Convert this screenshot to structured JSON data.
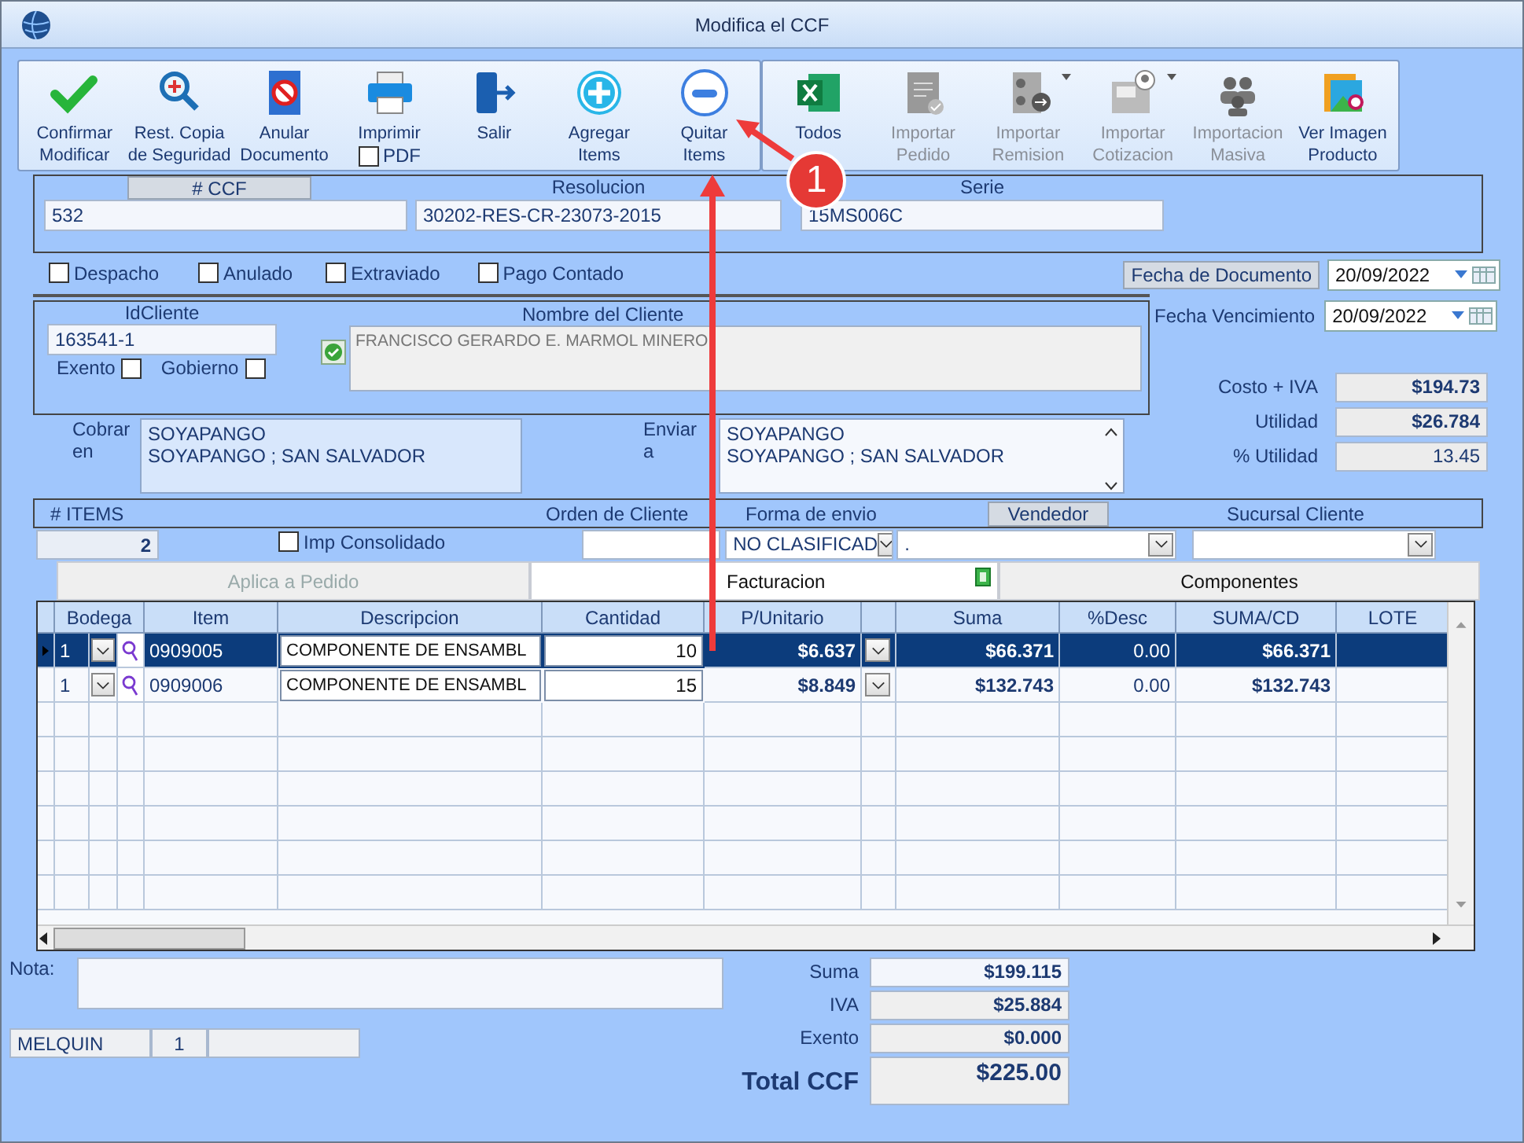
{
  "window": {
    "title": "Modifica el CCF"
  },
  "toolbar": {
    "groups": [
      {
        "buttons": [
          {
            "kind": "confirm",
            "lines": [
              "Confirmar",
              "Modificar"
            ],
            "disabled": false
          },
          {
            "kind": "restore",
            "lines": [
              "Rest. Copia",
              "de Seguridad"
            ],
            "disabled": false
          },
          {
            "kind": "void",
            "lines": [
              "Anular",
              "Documento"
            ],
            "disabled": false
          },
          {
            "kind": "print",
            "lines": [
              "Imprimir"
            ],
            "disabled": false,
            "checkbox": {
              "label": "PDF",
              "checked": false
            }
          },
          {
            "kind": "exit",
            "lines": [
              "Salir"
            ],
            "disabled": false
          },
          {
            "kind": "add",
            "lines": [
              "Agregar",
              "Items"
            ],
            "disabled": false
          },
          {
            "kind": "remove",
            "lines": [
              "Quitar",
              "Items"
            ],
            "disabled": false
          }
        ]
      },
      {
        "buttons": [
          {
            "kind": "excel",
            "lines": [
              "Todos"
            ],
            "disabled": false
          },
          {
            "kind": "import_order",
            "lines": [
              "Importar",
              "Pedido"
            ],
            "disabled": true
          },
          {
            "kind": "import_remission",
            "lines": [
              "Importar",
              "Remision"
            ],
            "disabled": true,
            "menu": true
          },
          {
            "kind": "import_quote",
            "lines": [
              "Importar",
              "Cotizacion"
            ],
            "disabled": true,
            "menu": true
          },
          {
            "kind": "mass_import",
            "lines": [
              "Importacion",
              "Masiva"
            ],
            "disabled": true
          },
          {
            "kind": "image",
            "lines": [
              "Ver Imagen",
              "Producto"
            ],
            "disabled": false
          }
        ]
      }
    ]
  },
  "document": {
    "fields": [
      {
        "label": "# CCF",
        "value": "532",
        "highlighted": true
      },
      {
        "label": "Resolucion",
        "value": "30202-RES-CR-23073-2015",
        "highlighted": false
      },
      {
        "label": "Serie",
        "value": "15MS006C",
        "highlighted": false
      }
    ]
  },
  "flags": [
    {
      "label": "Despacho",
      "checked": false
    },
    {
      "label": "Anulado",
      "checked": false
    },
    {
      "label": "Extraviado",
      "checked": false
    },
    {
      "label": "Pago Contado",
      "checked": false
    }
  ],
  "fecha_documento": {
    "label": "Fecha de  Documento",
    "value": "20/09/2022"
  },
  "cliente": {
    "id_label": "IdCliente",
    "id": "163541-1",
    "options": [
      {
        "label": "Exento",
        "checked": false
      },
      {
        "label": "Gobierno",
        "checked": false
      }
    ],
    "verified": true,
    "name_label": "Nombre del Cliente",
    "name": "FRANCISCO GERARDO E. MARMOL MINERO"
  },
  "fecha_vencimiento": {
    "label": "Fecha Vencimiento",
    "value": "20/09/2022"
  },
  "costos": [
    {
      "label": "Costo + IVA",
      "value": "$194.73",
      "bold": true
    },
    {
      "label": "Utilidad",
      "value": "$26.784",
      "bold": true
    },
    {
      "label": "% Utilidad",
      "value": "13.45",
      "bold": false
    }
  ],
  "cobrar": {
    "label": "Cobrar en",
    "lines": [
      "SOYAPANGO",
      "SOYAPANGO ; SAN SALVADOR"
    ]
  },
  "enviar": {
    "label": "Enviar a",
    "lines": [
      "SOYAPANGO",
      "SOYAPANGO ; SAN SALVADOR"
    ]
  },
  "items_bar": {
    "count_label": "# ITEMS",
    "count": "2",
    "consolidado": {
      "label": "Imp Consolidado",
      "checked": false
    },
    "orden_label": "Orden de Cliente",
    "forma_label": "Forma de envio",
    "forma": "NO CLASIFICAD",
    "vendedor_label": "Vendedor",
    "vendedor": ".",
    "sucursal_label": "Sucursal Cliente"
  },
  "tabs": [
    {
      "label": "Aplica a Pedido",
      "selected": false,
      "disabled": true
    },
    {
      "label": "Facturacion",
      "selected": true,
      "disabled": false
    },
    {
      "label": "Componentes",
      "selected": false,
      "disabled": false
    }
  ],
  "grid": {
    "columns": [
      "Bodega",
      "Item",
      "Descripcion",
      "Cantidad",
      "P/Unitario",
      "Suma",
      "%Desc",
      "SUMA/CD",
      "LOTE"
    ],
    "rows": [
      {
        "selected": true,
        "bodega": "1",
        "item": "0909005",
        "descripcion": "COMPONENTE DE ENSAMBL",
        "cantidad": "10",
        "p_unitario": "$6.637",
        "suma": "$66.371",
        "desc": "0.00",
        "suma_cd": "$66.371"
      },
      {
        "selected": false,
        "bodega": "1",
        "item": "0909006",
        "descripcion": "COMPONENTE DE ENSAMBL",
        "cantidad": "15",
        "p_unitario": "$8.849",
        "suma": "$132.743",
        "desc": "0.00",
        "suma_cd": "$132.743"
      }
    ]
  },
  "nota": {
    "label": "Nota:"
  },
  "footer_fields": [
    "MELQUIN",
    "1"
  ],
  "totales": [
    {
      "label": "Suma",
      "value": "$199.115"
    },
    {
      "label": "IVA",
      "value": "$25.884"
    },
    {
      "label": "Exento",
      "value": "$0.000"
    }
  ],
  "total": {
    "label": "Total CCF",
    "value": "$225.00"
  },
  "annotation": {
    "badge": "1"
  }
}
